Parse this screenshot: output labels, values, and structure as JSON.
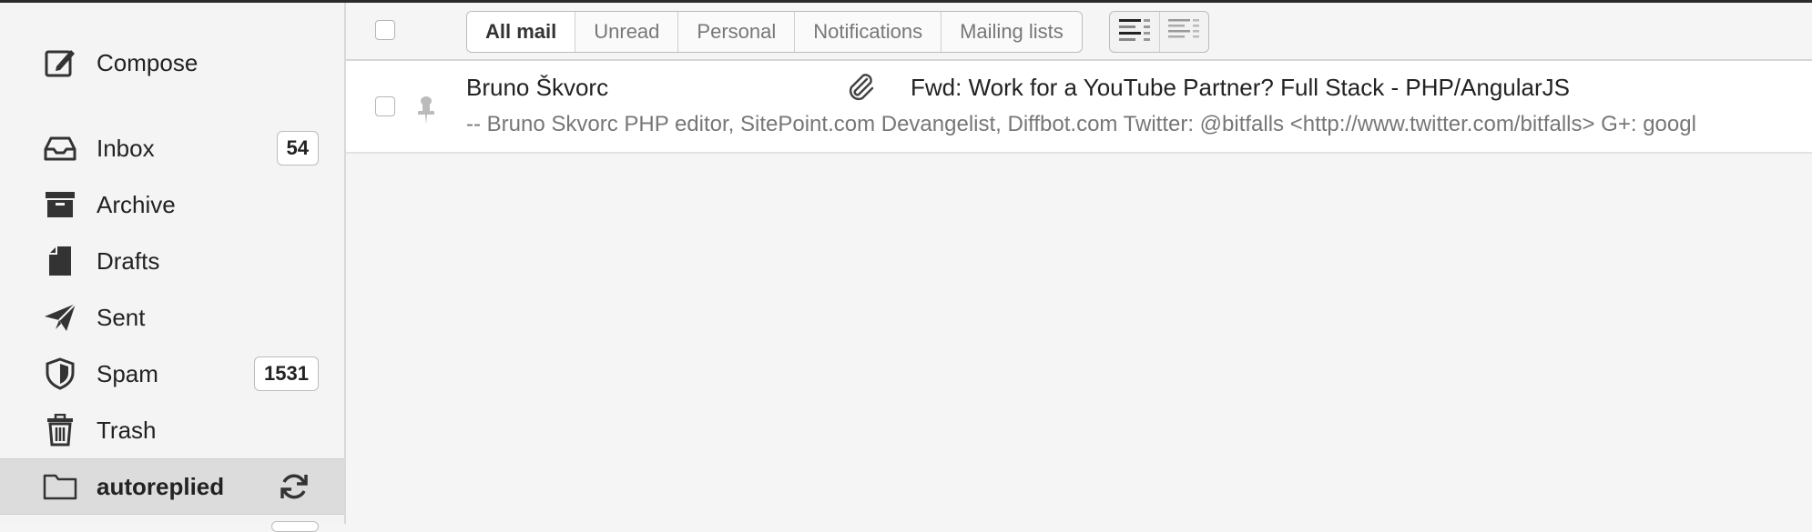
{
  "sidebar": {
    "items": [
      {
        "label": "Compose",
        "icon": "compose-icon"
      },
      {
        "label": "Inbox",
        "icon": "inbox-icon",
        "badge": "54"
      },
      {
        "label": "Archive",
        "icon": "archive-icon"
      },
      {
        "label": "Drafts",
        "icon": "drafts-icon"
      },
      {
        "label": "Sent",
        "icon": "send-icon"
      },
      {
        "label": "Spam",
        "icon": "shield-icon",
        "badge": "1531"
      },
      {
        "label": "Trash",
        "icon": "trash-icon"
      },
      {
        "label": "autoreplied",
        "icon": "folder-icon",
        "active": true,
        "action_icon": "refresh-icon"
      }
    ]
  },
  "toolbar": {
    "tabs": [
      "All mail",
      "Unread",
      "Personal",
      "Notifications",
      "Mailing lists"
    ],
    "active_tab": "All mail",
    "density_options": [
      "comfortable-density-icon",
      "compact-density-icon"
    ]
  },
  "messages": [
    {
      "from": "Bruno Škvorc",
      "subject": "Fwd: Work for a YouTube Partner? Full Stack - PHP/AngularJS",
      "preview": "-- Bruno Skvorc PHP editor, SitePoint.com Devangelist, Diffbot.com Twitter: @bitfalls <http://www.twitter.com/bitfalls> G+: googl",
      "has_attachment": true,
      "pinned": false
    }
  ]
}
